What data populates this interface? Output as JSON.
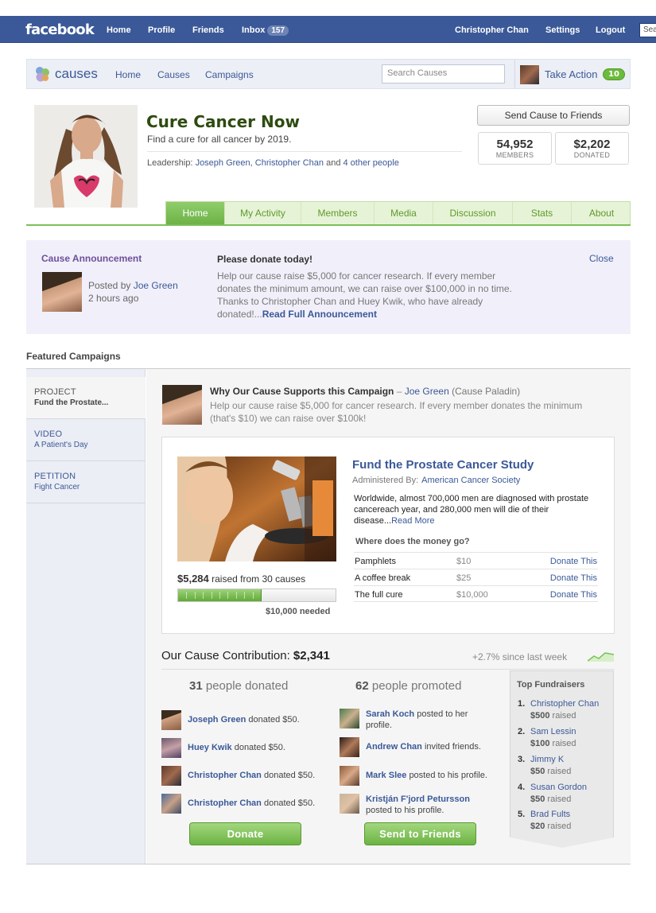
{
  "facebook": {
    "logo": "facebook",
    "nav": [
      "Home",
      "Profile",
      "Friends"
    ],
    "inbox_label": "Inbox",
    "inbox_count": "157",
    "user": "Christopher Chan",
    "settings": "Settings",
    "logout": "Logout",
    "search_placeholder": "Sea"
  },
  "causes_bar": {
    "logo_text": "causes",
    "nav": [
      "Home",
      "Causes",
      "Campaigns"
    ],
    "search_placeholder": "Search Causes",
    "take_action": "Take Action",
    "take_action_count": "10"
  },
  "cause": {
    "title": "Cure Cancer Now",
    "subtitle": "Find a cure for all cancer by 2019.",
    "leadership_label": "Leadership:",
    "leader1": "Joseph Green",
    "leader2": "Christopher Chan",
    "and_text": "and",
    "others": "4 other people",
    "send_button": "Send Cause to Friends",
    "members_value": "54,952",
    "members_label": "MEMBERS",
    "donated_value": "$2,202",
    "donated_label": "DONATED"
  },
  "tabs": [
    "Home",
    "My Activity",
    "Members",
    "Media",
    "Discussion",
    "Stats",
    "About"
  ],
  "announcement": {
    "heading": "Cause Announcement",
    "posted_by": "Posted by",
    "poster": "Joe Green",
    "time": "2 hours ago",
    "title": "Please donate today!",
    "body": "Help our cause raise $5,000 for cancer research. If every member donates the minimum amount, we can raise over $100,000 in no time. Thanks to Christopher Chan and Huey Kwik, who have already donated!...",
    "read_more": "Read Full Announcement",
    "close": "Close"
  },
  "featured": {
    "heading": "Featured Campaigns",
    "sidebar": [
      {
        "type": "PROJECT",
        "name": "Fund the Prostate..."
      },
      {
        "type": "VIDEO",
        "name": "A Patient's Day"
      },
      {
        "type": "PETITION",
        "name": "Fight Cancer"
      }
    ],
    "why_title": "Why Our Cause Supports this Campaign",
    "why_dash": "–",
    "why_author": "Joe Green",
    "why_role": "(Cause Paladin)",
    "why_text": "Help our cause raise $5,000 for cancer research. If every member donates the minimum (that's $10) we can raise over $100k!"
  },
  "campaign": {
    "title": "Fund the Prostate Cancer Study",
    "administered_label": "Administered By:",
    "administrator": "American Cancer Society",
    "description": "Worldwide, almost 700,000 men are diagnosed with prostate cancereach year, and 280,000 men will die of their disease...",
    "read_more": "Read More",
    "raised_amount": "$5,284",
    "raised_text": "raised from 30 causes",
    "progress_fraction": 0.53,
    "needed": "$10,000 needed",
    "money_heading": "Where does the money go?",
    "money_items": [
      {
        "item": "Pamphlets",
        "price": "$10",
        "action": "Donate This"
      },
      {
        "item": "A coffee break",
        "price": "$25",
        "action": "Donate This"
      },
      {
        "item": "The full cure",
        "price": "$10,000",
        "action": "Donate This"
      }
    ]
  },
  "contribution": {
    "label": "Our Cause Contribution:",
    "amount": "$2,341",
    "week_change": "+2.7% since last week",
    "donated_count": "31",
    "donated_label": "people donated",
    "promoted_count": "62",
    "promoted_label": "people promoted",
    "donors": [
      {
        "name": "Joseph Green",
        "action": "donated $50."
      },
      {
        "name": "Huey Kwik",
        "action": "donated $50."
      },
      {
        "name": "Christopher Chan",
        "action": "donated $50."
      },
      {
        "name": "Christopher Chan",
        "action": "donated $50."
      }
    ],
    "promoters": [
      {
        "name": "Sarah Koch",
        "action": "posted to her",
        "action2": "profile."
      },
      {
        "name": "Andrew Chan",
        "action": "invited friends.",
        "action2": ""
      },
      {
        "name": "Mark Slee",
        "action": "posted to his profile.",
        "action2": ""
      },
      {
        "name": "Kristján F'jord Petursson",
        "action": "",
        "action2": "posted to his profile."
      }
    ],
    "donate_button": "Donate",
    "send_button": "Send to Friends"
  },
  "top_fundraisers": {
    "heading": "Top Fundraisers",
    "items": [
      {
        "rank": "1.",
        "name": "Christopher Chan",
        "amount": "$500",
        "suffix": "raised"
      },
      {
        "rank": "2.",
        "name": "Sam Lessin",
        "amount": "$100",
        "suffix": "raised"
      },
      {
        "rank": "3.",
        "name": "Jimmy K",
        "amount": "$50",
        "suffix": "raised"
      },
      {
        "rank": "4.",
        "name": "Susan Gordon",
        "amount": "$50",
        "suffix": "raised"
      },
      {
        "rank": "5.",
        "name": "Brad Fults",
        "amount": "$20",
        "suffix": "raised"
      }
    ]
  }
}
